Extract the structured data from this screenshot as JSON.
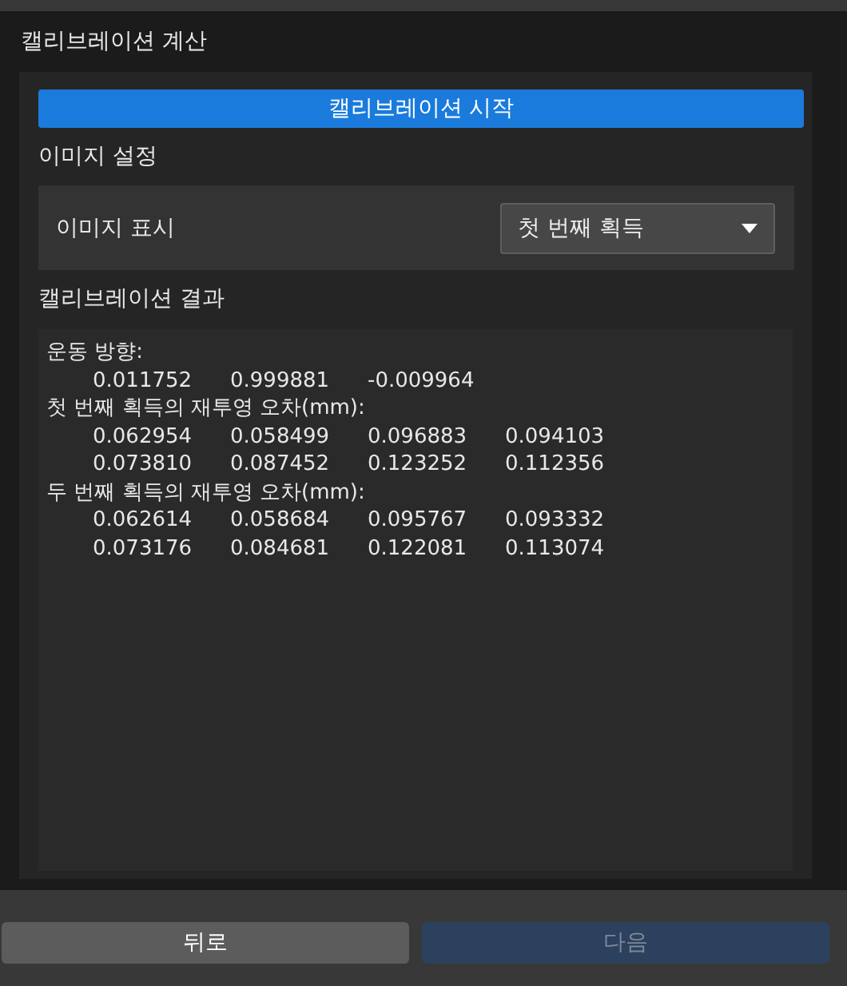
{
  "window": {
    "title": "캘리브레이션 계산"
  },
  "start_button": {
    "label": "캘리브레이션 시작"
  },
  "image_settings": {
    "heading": "이미지 설정",
    "display_label": "이미지 표시",
    "display_value": "첫 번째 획득"
  },
  "results": {
    "heading": "캘리브레이션 결과",
    "lines": [
      {
        "kind": "heading",
        "text": "운동 방향:"
      },
      {
        "kind": "values",
        "values": [
          "0.011752",
          "0.999881",
          "-0.009964"
        ]
      },
      {
        "kind": "heading",
        "text": "첫 번째 획득의 재투영 오차(mm):"
      },
      {
        "kind": "values",
        "values": [
          "0.062954",
          "0.058499",
          "0.096883",
          "0.094103"
        ]
      },
      {
        "kind": "values",
        "values": [
          "0.073810",
          "0.087452",
          "0.123252",
          "0.112356"
        ]
      },
      {
        "kind": "heading",
        "text": "두 번째 획득의 재투영 오차(mm):"
      },
      {
        "kind": "values",
        "values": [
          "0.062614",
          "0.058684",
          "0.095767",
          "0.093332"
        ]
      },
      {
        "kind": "values",
        "values": [
          "0.073176",
          "0.084681",
          "0.122081",
          "0.113074"
        ]
      }
    ]
  },
  "buttons": [
    {
      "label": "뒤로",
      "kind": "secondary",
      "disabled": false
    },
    {
      "label": "다음",
      "kind": "primary",
      "disabled": true
    }
  ]
}
